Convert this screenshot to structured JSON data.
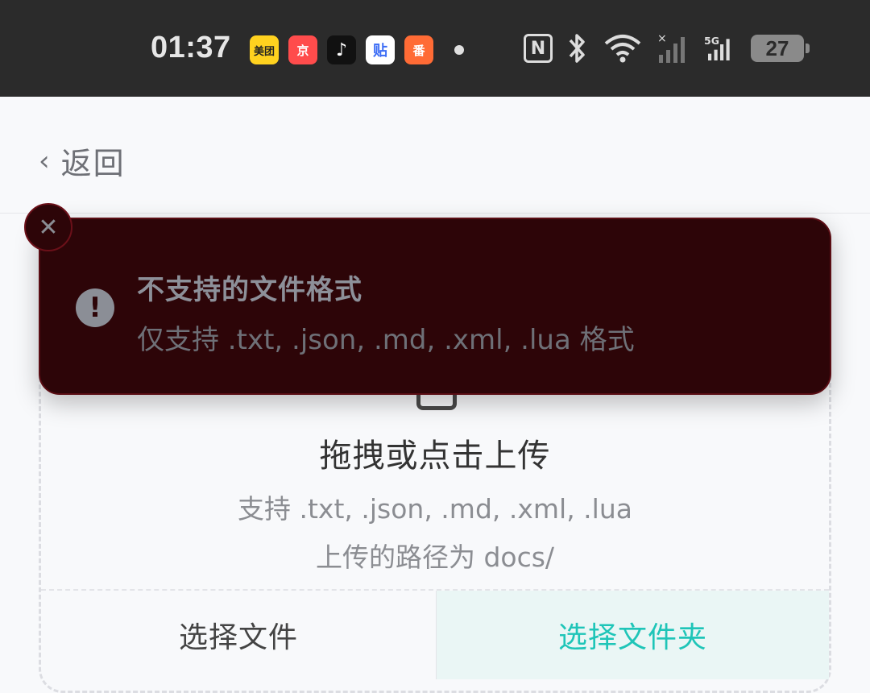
{
  "status_bar": {
    "time": "01:37",
    "apps": [
      "美团",
      "京",
      "♪",
      "贴",
      "番"
    ],
    "network_label": "5G",
    "battery": "27"
  },
  "header": {
    "back_chevron": "‹",
    "back_label": "返回"
  },
  "upload": {
    "title": "拖拽或点击上传",
    "hint_formats": "支持 .txt, .json, .md, .xml, .lua",
    "hint_path": "上传的路径为 docs/",
    "select_file_label": "选择文件",
    "select_folder_label": "选择文件夹"
  },
  "toast": {
    "title": "不支持的文件格式",
    "message": "仅支持 .txt, .json, .md, .xml, .lua 格式",
    "alert_symbol": "!",
    "close_symbol": "✕"
  },
  "colors": {
    "accent": "#1fc5b8",
    "toast_bg": "#2d0508"
  }
}
